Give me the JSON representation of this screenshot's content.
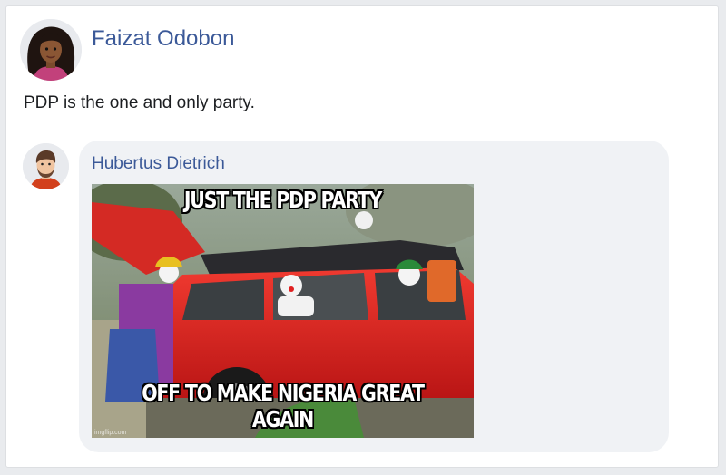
{
  "post": {
    "author": "Faizat Odobon",
    "text": "PDP is the one and only party."
  },
  "reply": {
    "author": "Hubertus Dietrich",
    "meme": {
      "top_caption": "JUST THE PDP PARTY",
      "bottom_caption": "OFF TO MAKE NIGERIA GREAT AGAIN",
      "watermark": "imgflip.com"
    }
  },
  "colors": {
    "link": "#3b5998",
    "bubble": "#f0f2f5",
    "car": "#e02020"
  }
}
